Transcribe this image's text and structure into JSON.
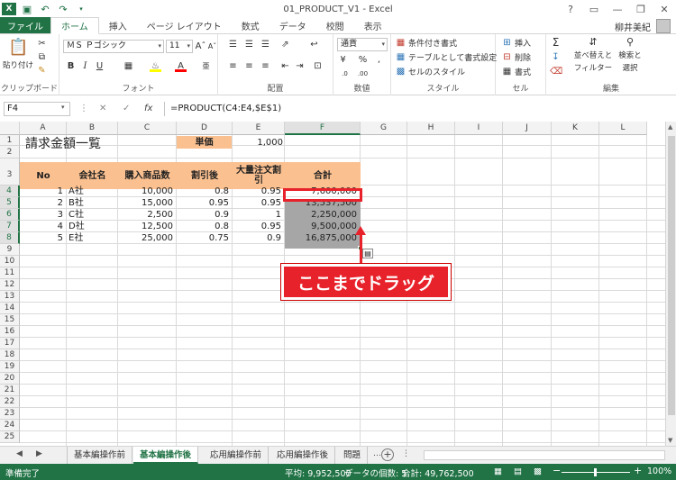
{
  "window": {
    "title": "01_PRODUCT_V1 - Excel",
    "controls": [
      "?",
      "▭",
      "—",
      "❐",
      "✕"
    ]
  },
  "quick_access": {
    "items": [
      "save-icon",
      "undo-icon",
      "redo-icon",
      "customize-icon"
    ]
  },
  "tabs": [
    "ファイル",
    "ホーム",
    "挿入",
    "ページ レイアウト",
    "数式",
    "データ",
    "校閲",
    "表示"
  ],
  "user": {
    "name": "柳井美紀"
  },
  "ribbon": {
    "clipboard": {
      "label": "クリップボード",
      "paste": "貼り付け"
    },
    "font": {
      "label": "フォント",
      "name": "ＭＳ Ｐゴシック",
      "size": "11"
    },
    "alignment": {
      "label": "配置"
    },
    "number": {
      "label": "数値",
      "format": "通貨"
    },
    "styles": {
      "label": "スタイル",
      "conditional": "条件付き書式",
      "table": "テーブルとして書式設定",
      "cell": "セルのスタイル"
    },
    "cells": {
      "label": "セル",
      "insert": "挿入",
      "delete": "削除",
      "format": "書式"
    },
    "editing": {
      "label": "編集",
      "sort": "並べ替えと",
      "filter": "フィルター",
      "find": "検索と",
      "select": "選択"
    }
  },
  "formula_bar": {
    "name_box": "F4",
    "fx": "fx",
    "formula": "=PRODUCT(C4:E4,$E$1)"
  },
  "columns": [
    "A",
    "B",
    "C",
    "D",
    "E",
    "F",
    "G",
    "H",
    "I",
    "J",
    "K",
    "L"
  ],
  "rows": [
    "1",
    "2",
    "3",
    "4",
    "5",
    "6",
    "7",
    "8",
    "9",
    "10",
    "11",
    "12",
    "13",
    "14",
    "15",
    "16",
    "17",
    "18",
    "19",
    "20",
    "21",
    "22",
    "23",
    "24",
    "25"
  ],
  "sheet": {
    "title": "請求金額一覧",
    "unit_price_label": "単価",
    "unit_price_value": "1,000",
    "headers": [
      "No",
      "会社名",
      "購入商品数",
      "割引後",
      "大量注文割引",
      "合計"
    ],
    "data": [
      {
        "no": "1",
        "company": "A社",
        "qty": "10,000",
        "disc": "0.8",
        "bulk": "0.95",
        "total": "7,600,000"
      },
      {
        "no": "2",
        "company": "B社",
        "qty": "15,000",
        "disc": "0.95",
        "bulk": "0.95",
        "total": "13,537,500"
      },
      {
        "no": "3",
        "company": "C社",
        "qty": "2,500",
        "disc": "0.9",
        "bulk": "1",
        "total": "2,250,000"
      },
      {
        "no": "4",
        "company": "D社",
        "qty": "12,500",
        "disc": "0.8",
        "bulk": "0.95",
        "total": "9,500,000"
      },
      {
        "no": "5",
        "company": "E社",
        "qty": "25,000",
        "disc": "0.75",
        "bulk": "0.9",
        "total": "16,875,000"
      }
    ]
  },
  "callout": {
    "text": "ここまでドラッグ"
  },
  "sheet_tabs": [
    "基本編操作前",
    "基本編操作後",
    "応用編操作前",
    "応用編操作後",
    "問題"
  ],
  "status": {
    "ready": "準備完了",
    "average": "平均: 9,952,500",
    "count": "データの個数: 5",
    "sum": "合計: 49,762,500",
    "zoom": "100%"
  },
  "colors": {
    "excel_green": "#217346",
    "header_fill": "#fac090",
    "callout_red": "#e8222b"
  }
}
